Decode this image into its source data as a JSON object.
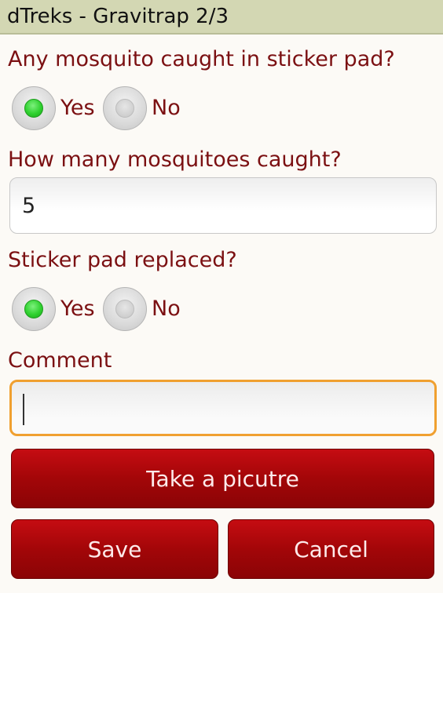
{
  "app": {
    "title": "dTreks - Gravitrap 2/3"
  },
  "questions": {
    "mosquito_caught": {
      "label": "Any mosquito caught in sticker pad?",
      "yes": "Yes",
      "no": "No",
      "selected": "Yes"
    },
    "count": {
      "label": "How many mosquitoes caught?",
      "value": "5"
    },
    "pad_replaced": {
      "label": "Sticker pad replaced?",
      "yes": "Yes",
      "no": "No",
      "selected": "Yes"
    },
    "comment": {
      "label": "Comment",
      "value": ""
    }
  },
  "buttons": {
    "take_picture": "Take a picutre",
    "save": "Save",
    "cancel": "Cancel"
  },
  "colors": {
    "accent": "#7b1012",
    "button": "#a30608",
    "focus": "#f0a030",
    "radio_on": "#2fd12f",
    "titlebar": "#d3d7b3"
  }
}
